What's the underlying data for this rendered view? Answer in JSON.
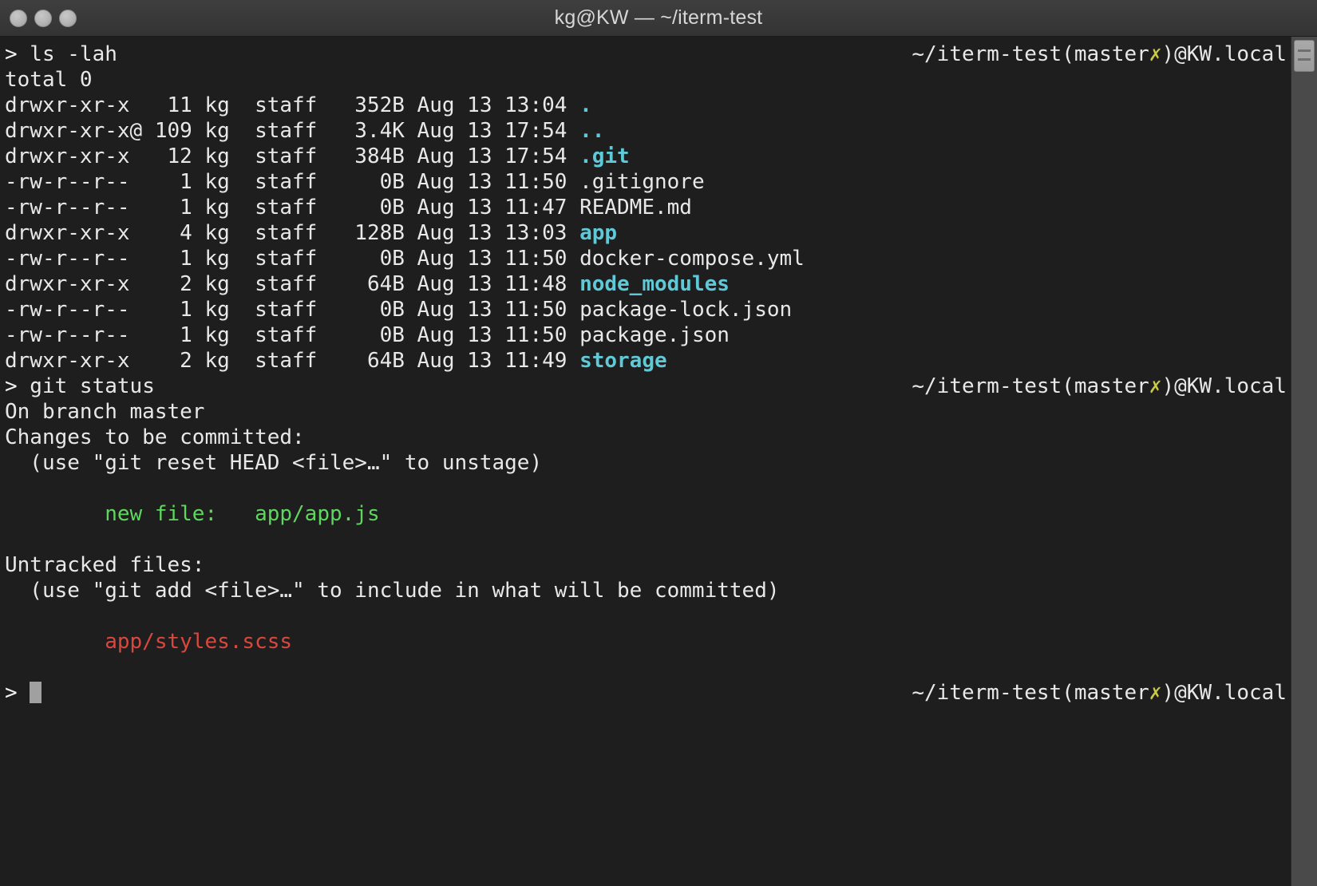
{
  "window": {
    "title": "kg@KW — ~/iterm-test",
    "traffic_lights": [
      "close",
      "minimize",
      "zoom"
    ],
    "colors": {
      "background": "#1e1e1e",
      "titlebar": "#3a3a3a",
      "foreground": "#e8e8e8",
      "directory": "#5fc9d8",
      "added": "#5fd75f",
      "untracked": "#d9483f",
      "branch_dirty": "#c8c84a"
    }
  },
  "terminal": {
    "right_prompt": "~/iterm-test(master✗)@KW.local",
    "prompt_symbol": ">",
    "cursor": "block",
    "lines": [
      {
        "id": "cmd-ls",
        "text": "> ls -lah",
        "color": "default",
        "right_prompt": true
      },
      {
        "id": "ls-total",
        "text": "total 0",
        "color": "default"
      },
      {
        "id": "ls-dot",
        "prefix": "drwxr-xr-x   11 kg  staff   352B Aug 13 13:04 ",
        "name": ".",
        "name_color": "dir"
      },
      {
        "id": "ls-dotdot",
        "prefix": "drwxr-xr-x@ 109 kg  staff   3.4K Aug 13 17:54 ",
        "name": "..",
        "name_color": "dir"
      },
      {
        "id": "ls-git",
        "prefix": "drwxr-xr-x   12 kg  staff   384B Aug 13 17:54 ",
        "name": ".git",
        "name_color": "dir"
      },
      {
        "id": "ls-gitignore",
        "prefix": "-rw-r--r--    1 kg  staff     0B Aug 13 11:50 ",
        "name": ".gitignore",
        "name_color": "default"
      },
      {
        "id": "ls-readme",
        "prefix": "-rw-r--r--    1 kg  staff     0B Aug 13 11:47 ",
        "name": "README.md",
        "name_color": "default"
      },
      {
        "id": "ls-app",
        "prefix": "drwxr-xr-x    4 kg  staff   128B Aug 13 13:03 ",
        "name": "app",
        "name_color": "dir"
      },
      {
        "id": "ls-docker",
        "prefix": "-rw-r--r--    1 kg  staff     0B Aug 13 11:50 ",
        "name": "docker-compose.yml",
        "name_color": "default"
      },
      {
        "id": "ls-node",
        "prefix": "drwxr-xr-x    2 kg  staff    64B Aug 13 11:48 ",
        "name": "node_modules",
        "name_color": "dir"
      },
      {
        "id": "ls-pkglock",
        "prefix": "-rw-r--r--    1 kg  staff     0B Aug 13 11:50 ",
        "name": "package-lock.json",
        "name_color": "default"
      },
      {
        "id": "ls-pkg",
        "prefix": "-rw-r--r--    1 kg  staff     0B Aug 13 11:50 ",
        "name": "package.json",
        "name_color": "default"
      },
      {
        "id": "ls-storage",
        "prefix": "drwxr-xr-x    2 kg  staff    64B Aug 13 11:49 ",
        "name": "storage",
        "name_color": "dir"
      },
      {
        "id": "cmd-git-status",
        "text": "> git status",
        "color": "default",
        "right_prompt": true
      },
      {
        "id": "gs-branch",
        "text": "On branch master",
        "color": "default"
      },
      {
        "id": "gs-staged-hdr",
        "text": "Changes to be committed:",
        "color": "default"
      },
      {
        "id": "gs-staged-hint",
        "text": "  (use \"git reset HEAD <file>…\" to unstage)",
        "color": "default"
      },
      {
        "id": "gs-blank-1",
        "text": "",
        "color": "default"
      },
      {
        "id": "gs-new-file",
        "text": "\tnew file:   app/app.js",
        "color": "green"
      },
      {
        "id": "gs-blank-2",
        "text": "",
        "color": "default"
      },
      {
        "id": "gs-untracked-hdr",
        "text": "Untracked files:",
        "color": "default"
      },
      {
        "id": "gs-untracked-hint",
        "text": "  (use \"git add <file>…\" to include in what will be committed)",
        "color": "default"
      },
      {
        "id": "gs-blank-3",
        "text": "",
        "color": "default"
      },
      {
        "id": "gs-untracked-1",
        "text": "\tapp/styles.scss",
        "color": "red"
      },
      {
        "id": "gs-blank-4",
        "text": "",
        "color": "default"
      },
      {
        "id": "cmd-final",
        "text": "> ",
        "color": "default",
        "right_prompt": true,
        "cursor": true
      }
    ]
  },
  "scrollbar": {
    "position": "right",
    "thumb_top_percent": 0
  }
}
